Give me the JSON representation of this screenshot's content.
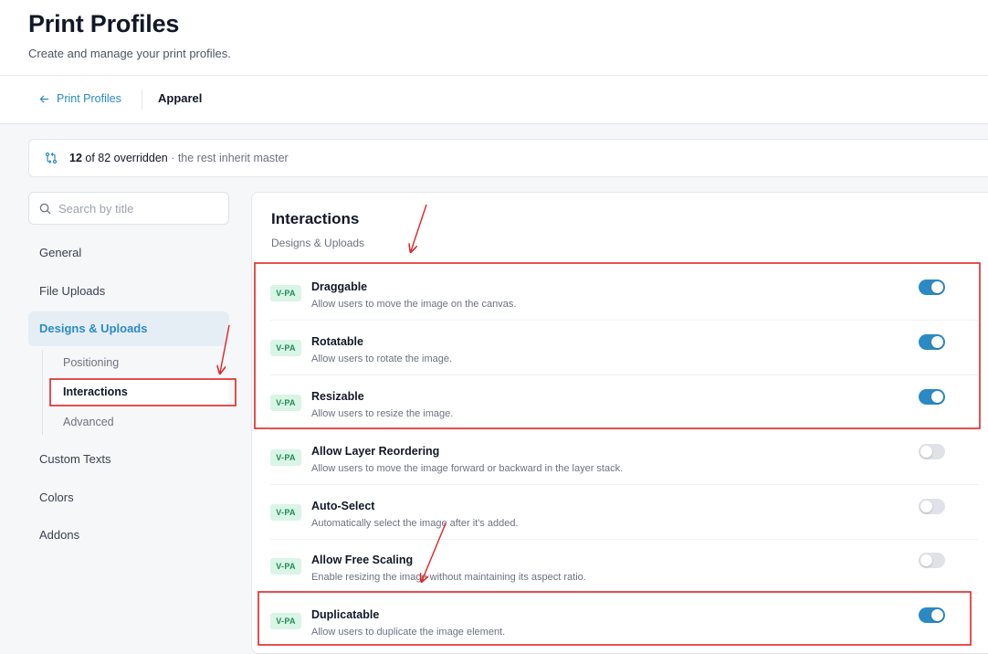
{
  "header": {
    "title": "Print Profiles",
    "subtitle": "Create and manage your print profiles."
  },
  "breadcrumb": {
    "back_label": "Print Profiles",
    "current": "Apparel"
  },
  "overrides": {
    "count": "12",
    "middle": " of 82 overridden",
    "suffix": " · the rest inherit master",
    "icon": "git-compare-icon"
  },
  "search": {
    "placeholder": "Search by title",
    "value": ""
  },
  "sidebar": {
    "items": [
      {
        "label": "General",
        "active": false
      },
      {
        "label": "File Uploads",
        "active": false
      },
      {
        "label": "Designs & Uploads",
        "active": true
      },
      {
        "label": "Custom Texts",
        "active": false
      },
      {
        "label": "Colors",
        "active": false
      },
      {
        "label": "Addons",
        "active": false
      }
    ],
    "sub_items": [
      {
        "label": "Positioning",
        "active": false
      },
      {
        "label": "Interactions",
        "active": true
      },
      {
        "label": "Advanced",
        "active": false
      }
    ]
  },
  "panel": {
    "title": "Interactions",
    "subtitle": "Designs & Uploads",
    "settings": [
      {
        "badge": "V-PA",
        "name": "Draggable",
        "description": "Allow users to move the image on the canvas.",
        "enabled": true
      },
      {
        "badge": "V-PA",
        "name": "Rotatable",
        "description": "Allow users to rotate the image.",
        "enabled": true
      },
      {
        "badge": "V-PA",
        "name": "Resizable",
        "description": "Allow users to resize the image.",
        "enabled": true
      },
      {
        "badge": "V-PA",
        "name": "Allow Layer Reordering",
        "description": "Allow users to move the image forward or backward in the layer stack.",
        "enabled": false
      },
      {
        "badge": "V-PA",
        "name": "Auto-Select",
        "description": "Automatically select the image after it's added.",
        "enabled": false
      },
      {
        "badge": "V-PA",
        "name": "Allow Free Scaling",
        "description": "Enable resizing the image without maintaining its aspect ratio.",
        "enabled": false
      },
      {
        "badge": "V-PA",
        "name": "Duplicatable",
        "description": "Allow users to duplicate the image element.",
        "enabled": true
      }
    ]
  },
  "colors": {
    "accent": "#2b8ac4",
    "badge_bg": "#d9f5e6",
    "badge_text": "#1f8a55",
    "annotation": "#e02424"
  }
}
